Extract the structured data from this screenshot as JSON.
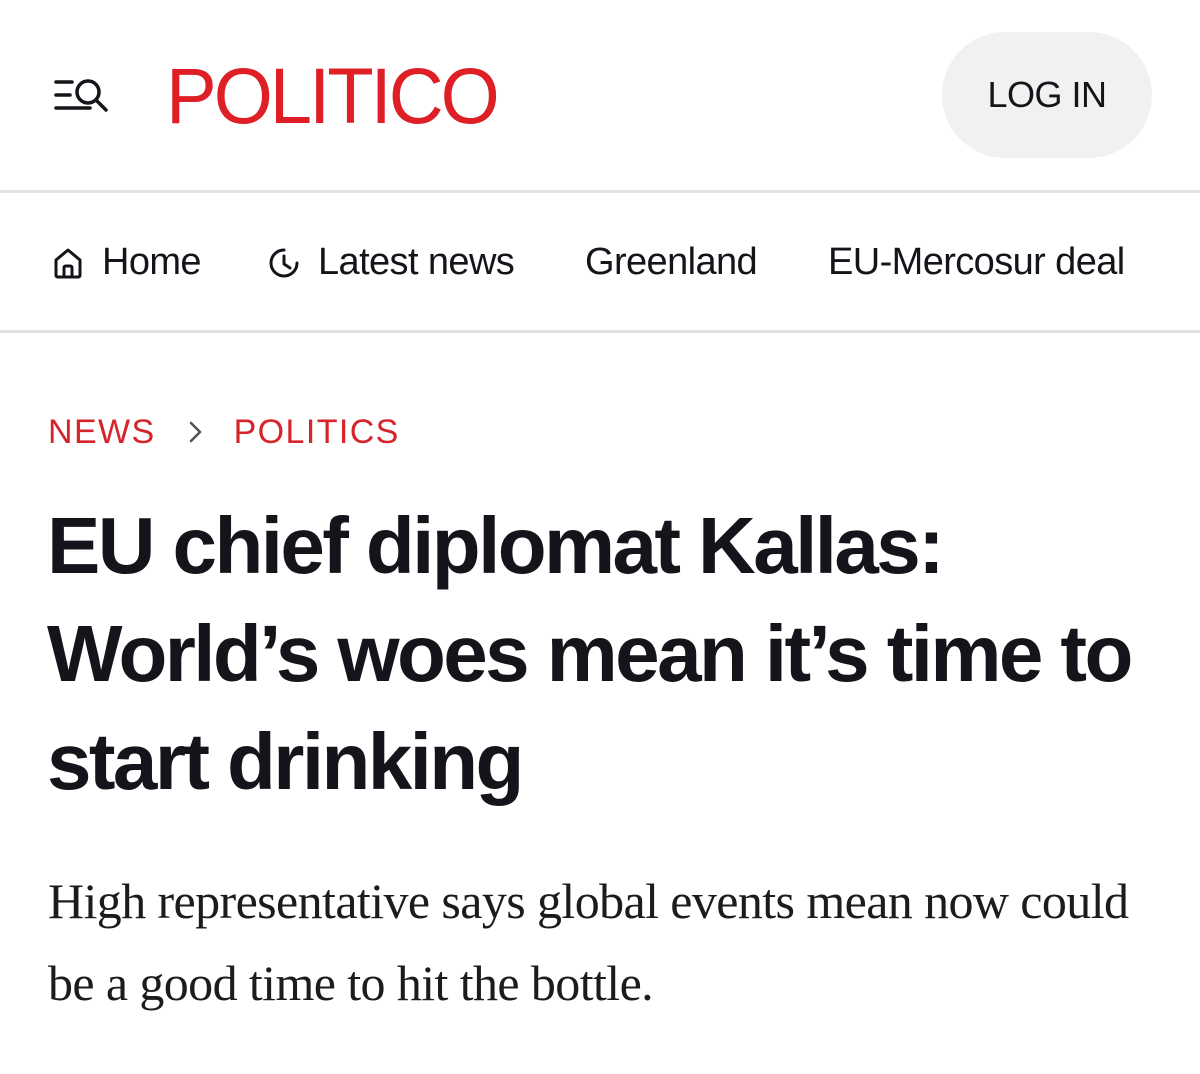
{
  "header": {
    "logo_text": "POLITICO",
    "login_label": "LOG IN",
    "menu_icon": "menu-search-icon",
    "brand_color": "#de1f26"
  },
  "nav": {
    "items": [
      {
        "label": "Home",
        "icon": "home-icon"
      },
      {
        "label": "Latest news",
        "icon": "clock-icon"
      },
      {
        "label": "Greenland"
      },
      {
        "label": "EU-Mercosur deal"
      }
    ]
  },
  "breadcrumb": {
    "items": [
      "NEWS",
      "POLITICS"
    ],
    "separator_icon": "chevron-right-icon",
    "color": "#d6242b"
  },
  "article": {
    "headline": "EU chief diplomat Kallas: World’s woes mean it’s time to start drinking",
    "subhead": "High representative says global events mean now could be a good time to hit the bottle."
  }
}
